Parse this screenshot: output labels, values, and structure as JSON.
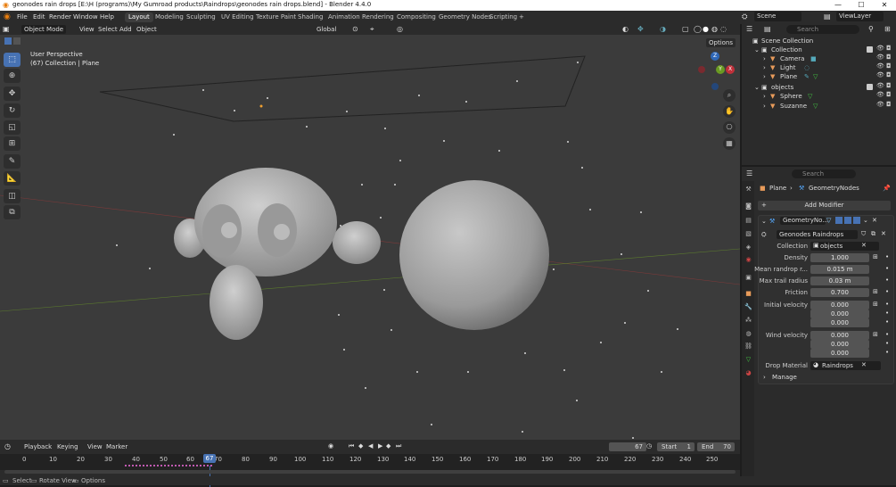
{
  "window": {
    "title": "geonodes rain drops [E:\\H (programs)\\My Gumroad products\\Raindrops\\geonodes rain drops.blend] - Blender 4.4.0",
    "minimize": "—",
    "maximize": "☐",
    "close": "✕"
  },
  "menu": [
    "File",
    "Edit",
    "Render",
    "Window",
    "Help"
  ],
  "workspaces": [
    "Layout",
    "Modeling",
    "Sculpting",
    "UV Editing",
    "Texture Paint",
    "Shading",
    "Animation",
    "Rendering",
    "Compositing",
    "Geometry Nodes",
    "Scripting",
    "+"
  ],
  "active_workspace": "Layout",
  "scene_label": "Scene",
  "viewlayer_label": "ViewLayer",
  "viewport_header": {
    "mode": "Object Mode",
    "menus": [
      "View",
      "Select",
      "Add",
      "Object"
    ],
    "transform": "Global",
    "options": "Options"
  },
  "viewport": {
    "perspective": "User Perspective",
    "collection_info": "(67) Collection | Plane",
    "gizmo_axes": {
      "z": "Z",
      "y": "Y",
      "x": "X"
    }
  },
  "outliner": {
    "search_placeholder": "Search",
    "rows": [
      {
        "label": "Scene Collection",
        "depth": 0
      },
      {
        "label": "Collection",
        "depth": 1
      },
      {
        "label": "Camera",
        "depth": 2
      },
      {
        "label": "Light",
        "depth": 2
      },
      {
        "label": "Plane",
        "depth": 2
      },
      {
        "label": "objects",
        "depth": 1
      },
      {
        "label": "Sphere",
        "depth": 2
      },
      {
        "label": "Suzanne",
        "depth": 2
      }
    ]
  },
  "properties": {
    "search_placeholder": "Search",
    "breadcrumb_object": "Plane",
    "breadcrumb_modifier": "GeometryNodes",
    "add_modifier": "Add Modifier",
    "modifier_name": "GeometryNo...",
    "node_group": "Geonodes Raindrops",
    "collection_label": "Collection",
    "collection_value": "objects",
    "fields": [
      {
        "label": "Density",
        "value": "1.000"
      },
      {
        "label": "Mean randrop r...",
        "value": "0.015 m"
      },
      {
        "label": "Max trail radius",
        "value": "0.03 m"
      },
      {
        "label": "Friction",
        "value": "0.700"
      },
      {
        "label": "Initial velocity",
        "value": "0.000"
      },
      {
        "label": "",
        "value": "0.000"
      },
      {
        "label": "",
        "value": "0.000"
      },
      {
        "label": "Wind velocity",
        "value": "0.000"
      },
      {
        "label": "",
        "value": "0.000"
      },
      {
        "label": "",
        "value": "0.000"
      }
    ],
    "drop_material_label": "Drop Material",
    "drop_material_value": "Raindrops",
    "manage": "Manage"
  },
  "timeline": {
    "menus": [
      "Playback",
      "Keying",
      "View",
      "Marker"
    ],
    "current_frame": "67",
    "start_label": "Start",
    "start_value": "1",
    "end_label": "End",
    "end_value": "70",
    "ticks": [
      "0",
      "10",
      "20",
      "30",
      "40",
      "50",
      "60",
      "70",
      "80",
      "90",
      "100",
      "110",
      "120",
      "130",
      "140",
      "150",
      "160",
      "170",
      "180",
      "190",
      "200",
      "210",
      "220",
      "230",
      "240",
      "250"
    ],
    "playhead_label": "67"
  },
  "statusbar": {
    "select": "Select",
    "rotate": "Rotate View",
    "options": "Options"
  }
}
